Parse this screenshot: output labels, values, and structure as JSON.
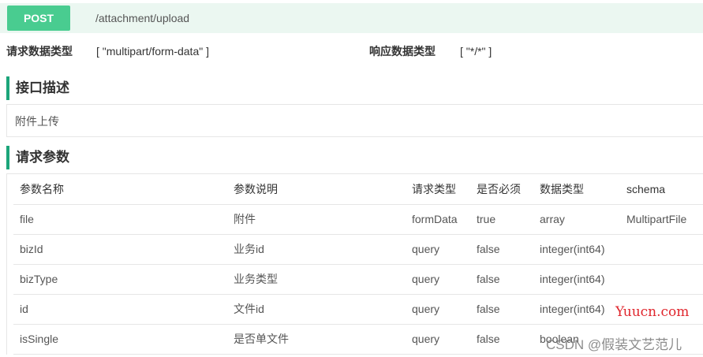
{
  "endpoint": {
    "method": "POST",
    "path": "/attachment/upload",
    "method_color": "#49cc90"
  },
  "meta": {
    "request_type_label": "请求数据类型",
    "request_type_value": "[ \"multipart/form-data\" ]",
    "response_type_label": "响应数据类型",
    "response_type_value": "[ \"*/*\" ]"
  },
  "description": {
    "heading": "接口描述",
    "text": "附件上传"
  },
  "params": {
    "heading": "请求参数",
    "columns": [
      "参数名称",
      "参数说明",
      "请求类型",
      "是否必须",
      "数据类型",
      "schema"
    ],
    "rows": [
      {
        "name": "file",
        "desc": "附件",
        "in": "formData",
        "required": "true",
        "type": "array",
        "schema": "MultipartFile"
      },
      {
        "name": "bizId",
        "desc": "业务id",
        "in": "query",
        "required": "false",
        "type": "integer(int64)",
        "schema": ""
      },
      {
        "name": "bizType",
        "desc": "业务类型",
        "in": "query",
        "required": "false",
        "type": "integer(int64)",
        "schema": ""
      },
      {
        "name": "id",
        "desc": "文件id",
        "in": "query",
        "required": "false",
        "type": "integer(int64)",
        "schema": ""
      },
      {
        "name": "isSingle",
        "desc": "是否单文件",
        "in": "query",
        "required": "false",
        "type": "boolean",
        "schema": ""
      }
    ]
  },
  "watermarks": {
    "site": "Yuucn.com",
    "author": "CSDN @假装文艺范儿"
  },
  "colors": {
    "accent": "#1ba57a",
    "formdata": "#8b2be2",
    "query": "#4b9fe8",
    "required_true": "#d80000"
  }
}
